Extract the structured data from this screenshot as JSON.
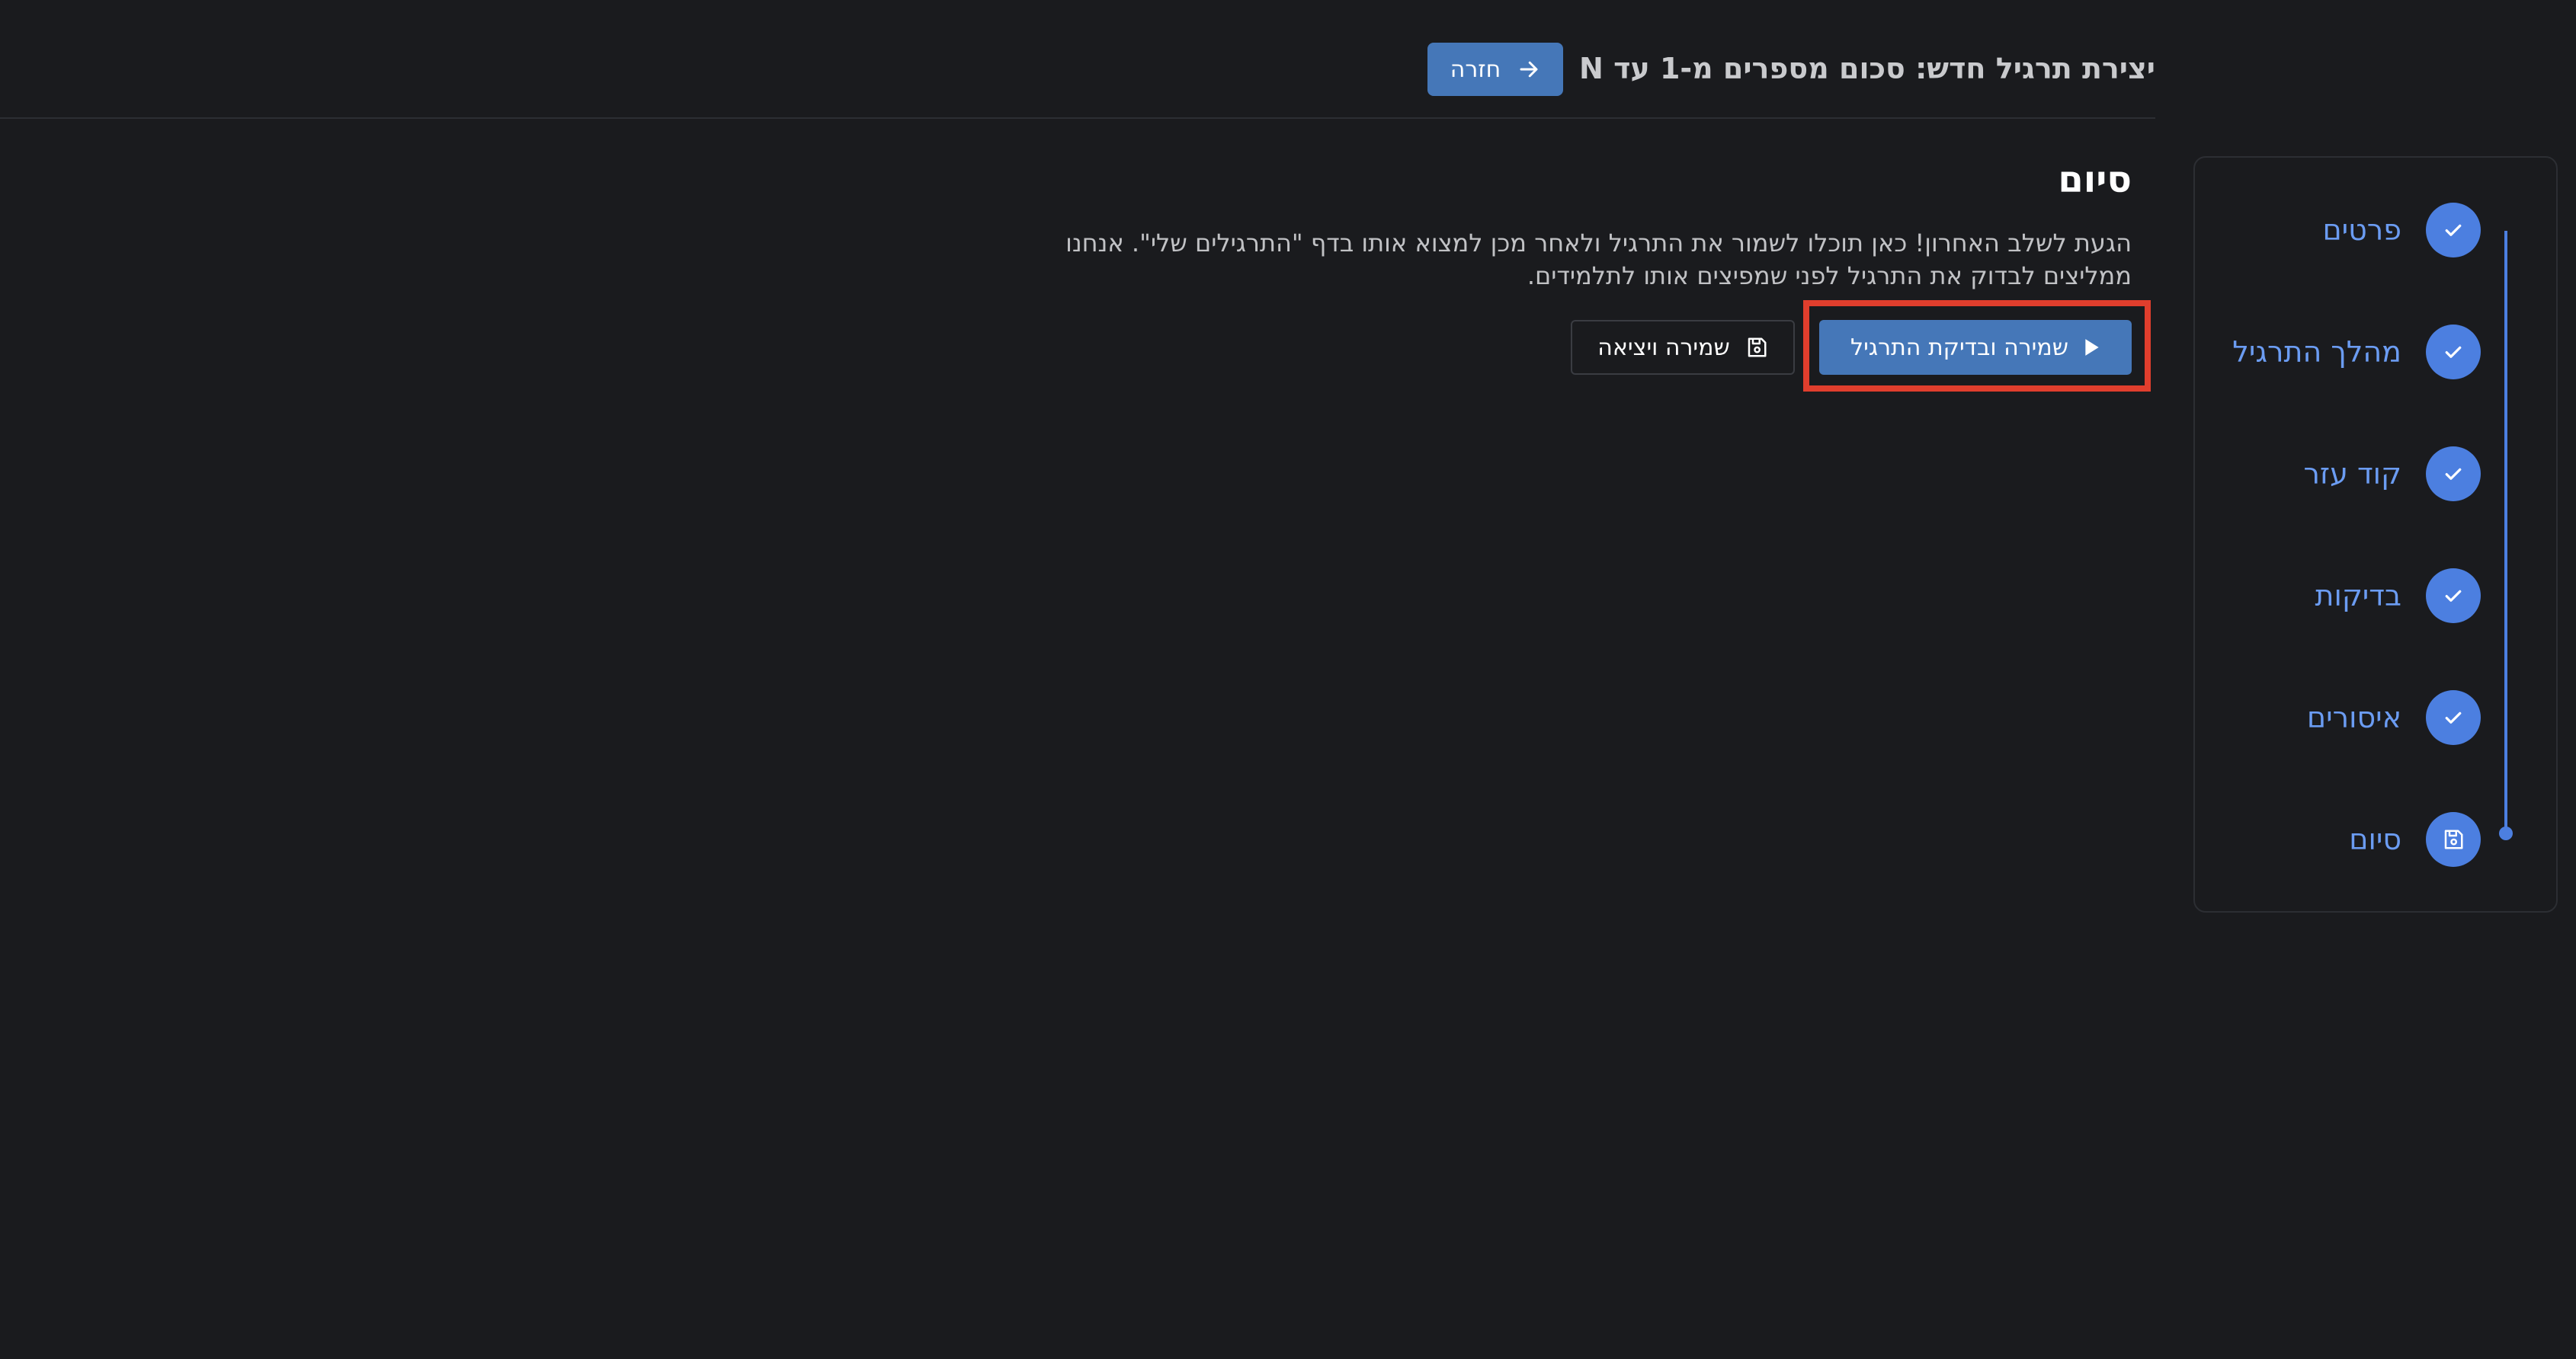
{
  "header": {
    "title": "יצירת תרגיל חדש: סכום מספרים מ-1 עד N",
    "back_label": "חזרה"
  },
  "main": {
    "section_title": "סיום",
    "description": "הגעת לשלב האחרון! כאן תוכלו לשמור את התרגיל ולאחר מכן למצוא אותו בדף \"התרגילים שלי\". אנחנו ממליצים לבדוק את התרגיל לפני שמפיצים אותו לתלמידים.",
    "save_and_check_label": "שמירה ובדיקת התרגיל",
    "save_and_exit_label": "שמירה ויציאה"
  },
  "stepper": {
    "steps": [
      {
        "label": "פרטים",
        "icon": "check-icon",
        "completed": true
      },
      {
        "label": "מהלך התרגיל",
        "icon": "check-icon",
        "completed": true
      },
      {
        "label": "קוד עזר",
        "icon": "check-icon",
        "completed": true
      },
      {
        "label": "בדיקות",
        "icon": "check-icon",
        "completed": true
      },
      {
        "label": "איסורים",
        "icon": "check-icon",
        "completed": true
      },
      {
        "label": "סיום",
        "icon": "floppy-disk-icon",
        "completed": false,
        "active": true
      }
    ]
  },
  "colors": {
    "background": "#1a1b1e",
    "primary_button": "#4577b8",
    "stepper_accent": "#4c7fe0",
    "stepper_label": "#6b9cf2",
    "highlight": "#e03e2d"
  }
}
